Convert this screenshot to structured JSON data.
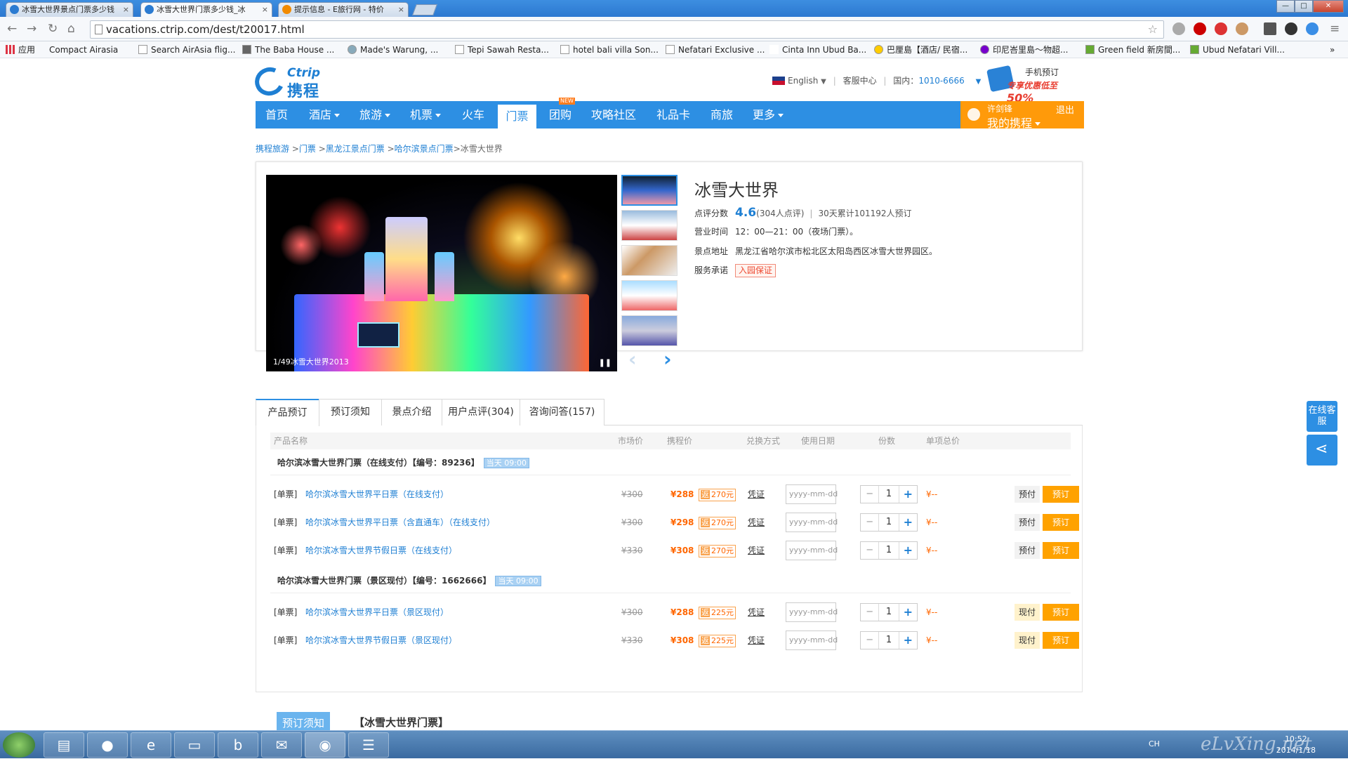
{
  "browser": {
    "tabs": [
      {
        "label": "冰雪大世界景点门票多少钱"
      },
      {
        "label": "冰雪大世界门票多少钱_冰"
      },
      {
        "label": "提示信息 - E旅行网 - 特价"
      }
    ],
    "url": "vacations.ctrip.com/dest/t20017.html",
    "window_buttons": {
      "minimize": "—",
      "maximize": "□",
      "close": "✕"
    },
    "bookmarks": [
      {
        "label": "应用"
      },
      {
        "label": "Compact Airasia"
      },
      {
        "label": "Search AirAsia flig..."
      },
      {
        "label": "The Baba House ..."
      },
      {
        "label": "Made's Warung, ..."
      },
      {
        "label": "Tepi Sawah Resta..."
      },
      {
        "label": "hotel bali villa Son..."
      },
      {
        "label": "Nefatari Exclusive ..."
      },
      {
        "label": "Cinta Inn Ubud Ba..."
      },
      {
        "label": "巴厘島【酒店/ 民宿..."
      },
      {
        "label": "印尼峇里島～物超..."
      },
      {
        "label": "Green field 新房間..."
      },
      {
        "label": "Ubud Nefatari Vill..."
      }
    ]
  },
  "header": {
    "logo_en": "Ctrip",
    "logo_cn": "携程",
    "language": "English",
    "service": "客服中心",
    "phone_label": "国内：",
    "phone": "1010-6666",
    "mobile_title": "手机预订",
    "mobile_promo": "专享优惠低至",
    "mobile_percent": "50%"
  },
  "nav": {
    "items": [
      {
        "label": "首页"
      },
      {
        "label": "酒店"
      },
      {
        "label": "旅游"
      },
      {
        "label": "机票"
      },
      {
        "label": "火车"
      },
      {
        "label": "门票"
      },
      {
        "label": "团购"
      },
      {
        "label": "攻略社区"
      },
      {
        "label": "礼品卡"
      },
      {
        "label": "商旅"
      },
      {
        "label": "更多"
      }
    ],
    "new_badge": "NEW",
    "user_name": "许剑锋",
    "my_ctrip": "我的携程",
    "logout": "退出"
  },
  "breadcrumb": {
    "items": [
      "携程旅游",
      "门票",
      "黑龙江景点门票",
      "哈尔滨景点门票"
    ],
    "current": "冰雪大世界"
  },
  "attraction": {
    "title": "冰雪大世界",
    "score_label": "点评分数",
    "score": "4.6",
    "review_count": "(304人点评)",
    "booked": "30天累计101192人预订",
    "hours_label": "营业时间",
    "hours": "12：00—21：00（夜场门票）。",
    "address_label": "景点地址",
    "address": "黑龙江省哈尔滨市松北区太阳岛西区冰雪大世界园区。",
    "service_label": "服务承诺",
    "service_badge": "入园保证",
    "image_caption": "1/49冰雪大世界2013"
  },
  "product_tabs": [
    {
      "label": "产品预订"
    },
    {
      "label": "预订须知"
    },
    {
      "label": "景点介绍"
    },
    {
      "label": "用户点评(304)"
    },
    {
      "label": "咨询问答(157)"
    }
  ],
  "table": {
    "headers": [
      "产品名称",
      "市场价",
      "携程价",
      "兑换方式",
      "使用日期",
      "份数",
      "单项总价"
    ],
    "date_placeholder": "yyyy-mm-dd",
    "groups": [
      {
        "title": "哈尔滨冰雪大世界门票（在线支付）【编号：89236】",
        "time": "当天 09:00",
        "rows": [
          {
            "type": "[单票]",
            "name": "哈尔滨冰雪大世界平日票（在线支付）",
            "market": "¥300",
            "price": "¥288",
            "rebate_tag": "返",
            "rebate": "270元",
            "voucher": "凭证",
            "qty": "1",
            "total": "¥--",
            "pay": "预付",
            "book": "预订"
          },
          {
            "type": "[单票]",
            "name": "哈尔滨冰雪大世界平日票（含直通车）（在线支付）",
            "market": "¥300",
            "price": "¥298",
            "rebate_tag": "返",
            "rebate": "270元",
            "voucher": "凭证",
            "qty": "1",
            "total": "¥--",
            "pay": "预付",
            "book": "预订"
          },
          {
            "type": "[单票]",
            "name": "哈尔滨冰雪大世界节假日票（在线支付）",
            "market": "¥330",
            "price": "¥308",
            "rebate_tag": "返",
            "rebate": "270元",
            "voucher": "凭证",
            "qty": "1",
            "total": "¥--",
            "pay": "预付",
            "book": "预订"
          }
        ]
      },
      {
        "title": "哈尔滨冰雪大世界门票（景区现付）【编号：1662666】",
        "time": "当天 09:00",
        "rows": [
          {
            "type": "[单票]",
            "name": "哈尔滨冰雪大世界平日票（景区现付）",
            "market": "¥300",
            "price": "¥288",
            "rebate_tag": "返",
            "rebate": "225元",
            "voucher": "凭证",
            "qty": "1",
            "total": "¥--",
            "pay": "现付",
            "book": "预订"
          },
          {
            "type": "[单票]",
            "name": "哈尔滨冰雪大世界节假日票（景区现付）",
            "market": "¥330",
            "price": "¥308",
            "rebate_tag": "返",
            "rebate": "225元",
            "voucher": "凭证",
            "qty": "1",
            "total": "¥--",
            "pay": "现付",
            "book": "预订"
          }
        ]
      }
    ]
  },
  "notice": {
    "tab": "预订须知",
    "title": "【冰雪大世界门票】"
  },
  "float": {
    "chat": "在线客服"
  },
  "taskbar": {
    "lang": "CH",
    "time": "10:52",
    "date": "2014/1/18",
    "watermark": "eLvXing.net"
  }
}
